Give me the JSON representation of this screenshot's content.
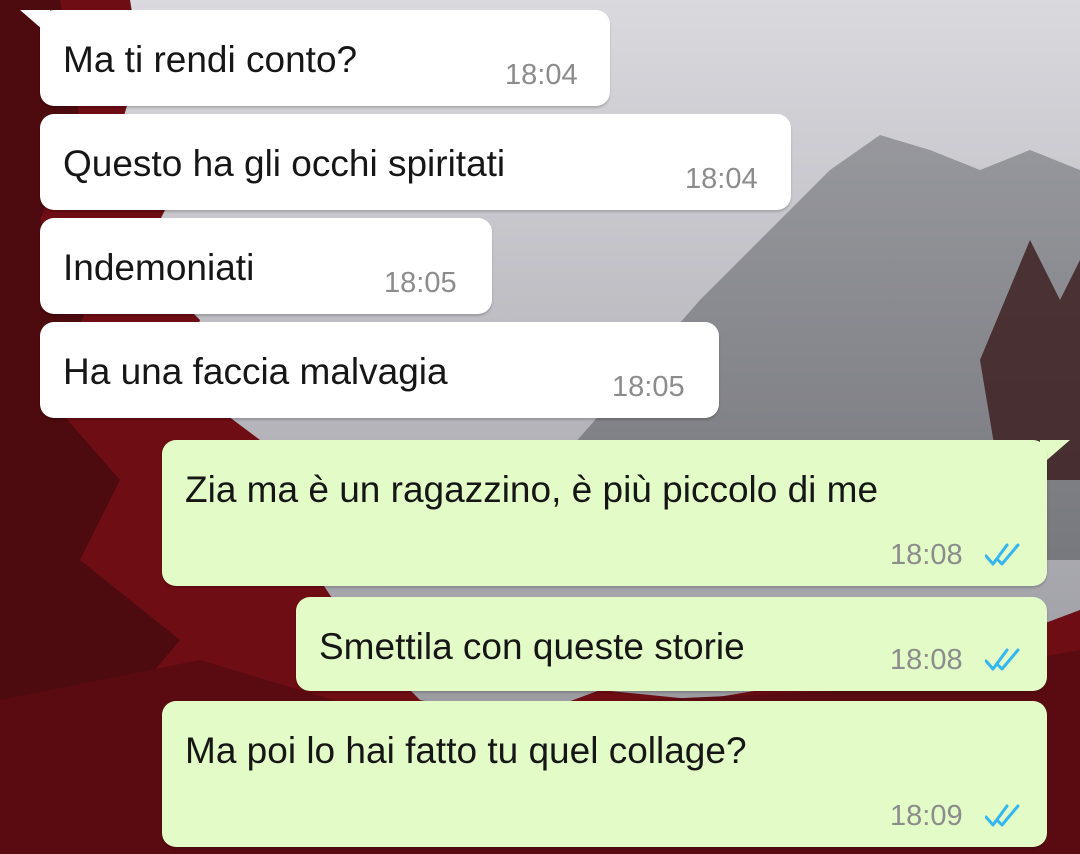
{
  "colors": {
    "incoming_bubble": "#ffffff",
    "outgoing_bubble": "#e2fbc7",
    "text": "#161616",
    "timestamp": "#8c8c8c",
    "read_ticks": "#34b7f1"
  },
  "wallpaper": {
    "description_icon": "mountain-red-trees-wallpaper"
  },
  "messages": [
    {
      "direction": "incoming",
      "text": "Ma ti rendi conto?",
      "time": "18:04"
    },
    {
      "direction": "incoming",
      "text": "Questo ha gli occhi spiritati",
      "time": "18:04"
    },
    {
      "direction": "incoming",
      "text": "Indemoniati",
      "time": "18:05"
    },
    {
      "direction": "incoming",
      "text": "Ha una faccia malvagia",
      "time": "18:05"
    },
    {
      "direction": "outgoing",
      "text": "Zia ma è un ragazzino, è più piccolo di me",
      "time": "18:08",
      "status": "read",
      "status_icon": "double-check-icon"
    },
    {
      "direction": "outgoing",
      "text": "Smettila con queste storie",
      "time": "18:08",
      "status": "read",
      "status_icon": "double-check-icon"
    },
    {
      "direction": "outgoing",
      "text": "Ma poi lo hai fatto tu quel collage?",
      "time": "18:09",
      "status": "read",
      "status_icon": "double-check-icon"
    }
  ]
}
